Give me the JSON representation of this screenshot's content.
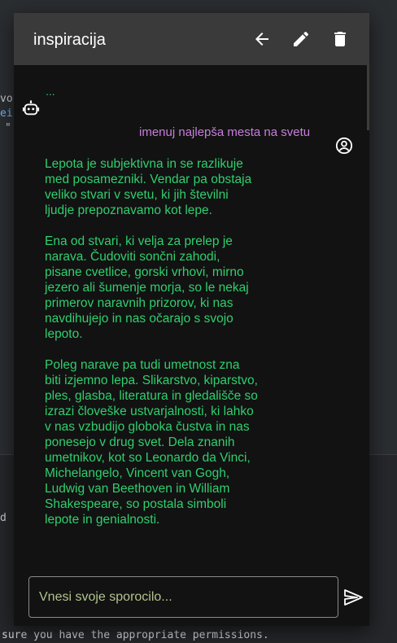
{
  "background": {
    "snippet_1": "vo",
    "snippet_2": "ei",
    "snippet_3": "\"",
    "snippet_4": "d",
    "footer_line": "sure you have the appropriate permissions."
  },
  "dialog": {
    "title": "inspiracija",
    "actions": {
      "back": "arrow-left-icon",
      "edit": "pencil-icon",
      "delete": "trash-icon"
    }
  },
  "chat": {
    "loading_text": "...",
    "user_message": "imenuj najlepša mesta na svetu",
    "bot_paragraphs": [
      "Lepota je subjektivna in se razlikuje med posamezniki. Vendar pa obstaja veliko stvari v svetu, ki jih številni ljudje prepoznavamo kot lepe.",
      "Ena od stvari, ki velja za prelep je narava. Čudoviti sončni zahodi, pisane cvetlice, gorski vrhovi, mirno jezero ali šumenje morja, so le nekaj primerov naravnih prizorov, ki nas navdihujejo in nas očarajo s svojo lepoto.",
      "Poleg narave pa tudi umetnost zna biti izjemno lepa. Slikarstvo, kiparstvo, ples, glasba, literatura in gledališče so izrazi človeške ustvarjalnosti, ki lahko v nas vzbudijo globoka čustva in nas ponesejo v drug svet. Dela znanih umetnikov, kot so Leonardo da Vinci, Michelangelo, Vincent van Gogh, Ludwig van Beethoven in William Shakespeare, so postala simboli lepote in genialnosti."
    ]
  },
  "composer": {
    "placeholder": "Vnesi svoje sporocilo...",
    "send_icon": "send-icon"
  },
  "colors": {
    "header_bg": "#3a3a3a",
    "dialog_bg": "#121212",
    "bot_text": "#2fcf6e",
    "user_text": "#c77fdc"
  }
}
